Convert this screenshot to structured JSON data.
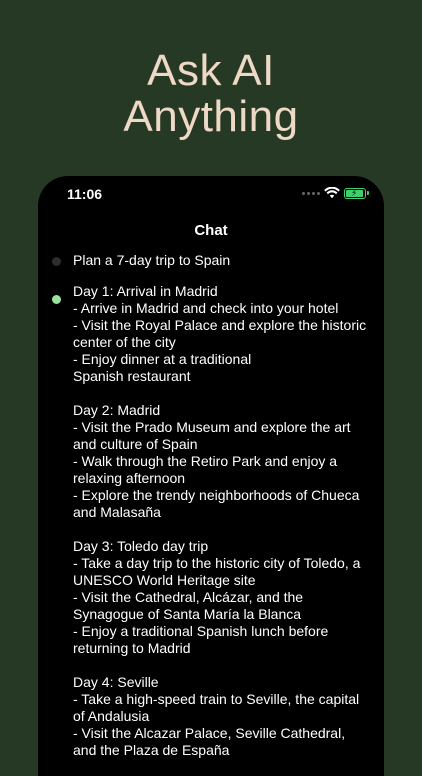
{
  "hero": {
    "line1": "Ask AI",
    "line2": "Anything"
  },
  "status_bar": {
    "time": "11:06"
  },
  "chat": {
    "title": "Chat",
    "user_message": "Plan a 7-day trip to Spain",
    "ai_paragraphs": [
      [
        "Day 1: Arrival in Madrid",
        "- Arrive in Madrid and check into your hotel",
        "- Visit the Royal Palace and explore the historic",
        "center of the city",
        "- Enjoy dinner at a traditional",
        "Spanish restaurant"
      ],
      [
        "Day 2: Madrid",
        "- Visit the Prado Museum and explore the art",
        "and culture of Spain",
        "- Walk through the Retiro Park and enjoy a",
        "relaxing afternoon",
        "- Explore the trendy neighborhoods of Chueca",
        "and Malasaña"
      ],
      [
        "Day 3: Toledo day trip",
        "- Take a day trip to the historic city of Toledo, a",
        "UNESCO World Heritage site",
        "- Visit the Cathedral, Alcázar, and the",
        "Synagogue of Santa María la Blanca",
        "- Enjoy a traditional Spanish lunch before",
        "returning to Madrid"
      ],
      [
        "Day 4: Seville",
        "- Take a high-speed train to Seville, the capital",
        "of Andalusia",
        "- Visit the Alcazar Palace, Seville Cathedral,",
        "and the Plaza de España"
      ]
    ]
  },
  "colors": {
    "background": "#263925",
    "hero_text": "#eed9c6",
    "ai_indicator": "#9ae39f",
    "battery": "#3fd06b"
  },
  "icons": [
    "wifi-icon",
    "battery-charging-icon",
    "signal-dots-icon"
  ]
}
